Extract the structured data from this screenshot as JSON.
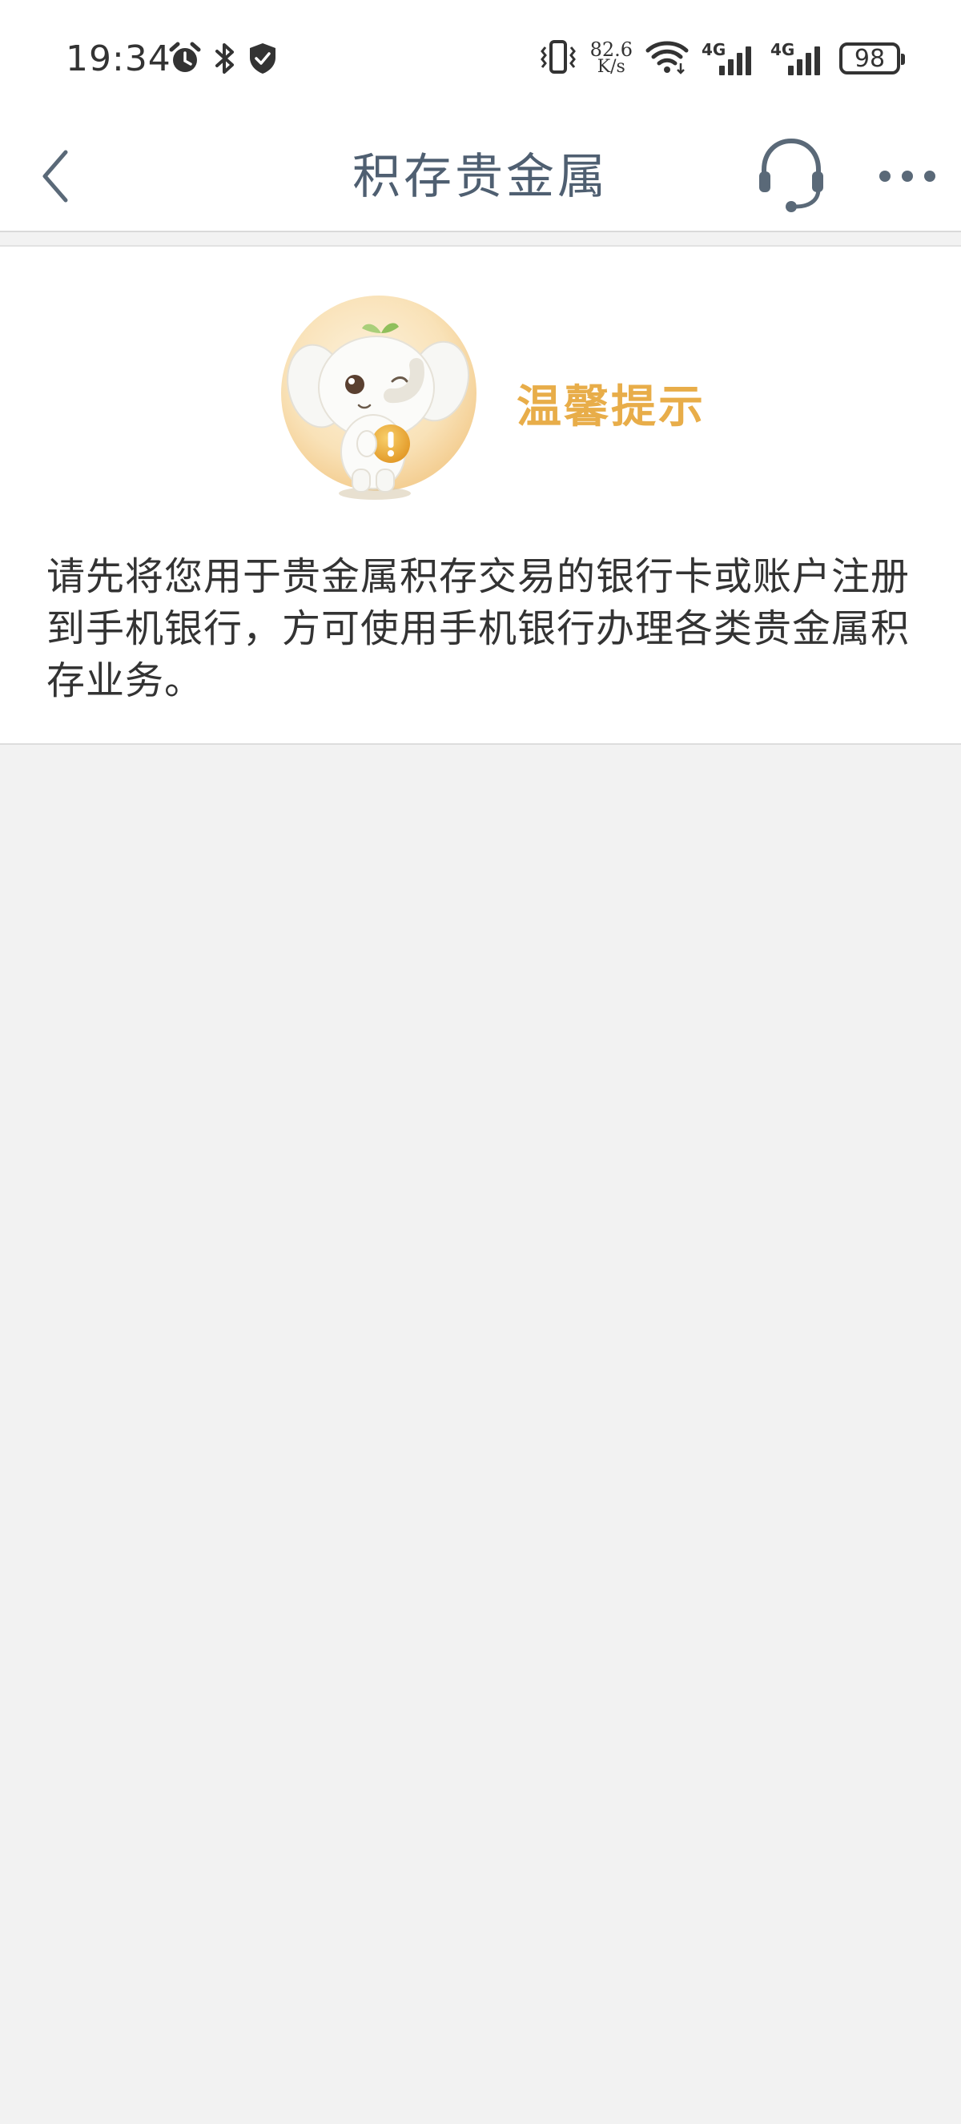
{
  "status_bar": {
    "time": "19:34",
    "net_speed_value": "82.6",
    "net_speed_unit": "K/s",
    "sim1_tag": "4G",
    "sim2_tag": "4G",
    "battery": "98",
    "icons": [
      "alarm-icon",
      "bluetooth-icon",
      "shield-icon",
      "vibrate-icon",
      "wifi-icon",
      "signal-icon",
      "battery-icon"
    ]
  },
  "nav": {
    "title": "积存贵金属",
    "icons": [
      "back-arrow-icon",
      "headset-icon",
      "more-dots-icon"
    ],
    "icon_color": "#5a6978"
  },
  "tip": {
    "title": "温馨提示",
    "body": "请先将您用于贵金属积存交易的银行卡或账户注册到手机银行，方可使用手机银行办理各类贵金属积存业务。",
    "accent_color": "#e8ad49"
  }
}
